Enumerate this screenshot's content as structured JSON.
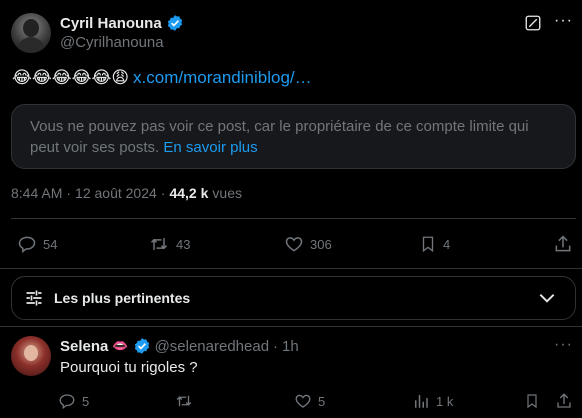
{
  "tweet": {
    "author_name": "Cyril Hanouna",
    "author_handle": "@Cyrilhanouna",
    "emoji_text": "😂😂😂😂😂😩",
    "link_text": "x.com/morandiniblog/…",
    "quote_notice": "Vous ne pouvez pas voir ce post, car le propriétaire de ce compte limite qui peut voir ses posts.",
    "quote_link": "En savoir plus",
    "time": "8:44 AM",
    "date": "12 août 2024",
    "views_count": "44,2 k",
    "views_label": "vues",
    "replies": "54",
    "reposts": "43",
    "likes": "306",
    "bookmarks": "4"
  },
  "sort": {
    "label": "Les plus pertinentes"
  },
  "reply": {
    "author_name": "Selena",
    "emoji": "👄",
    "author_handle": "@selenaredhead",
    "time": "1h",
    "text": "Pourquoi tu rigoles ?",
    "replies": "5",
    "reposts": "",
    "likes": "5",
    "views": "1 k"
  },
  "colors": {
    "accent": "#1d9bf0",
    "muted": "#71767b",
    "border": "#2f3336"
  }
}
